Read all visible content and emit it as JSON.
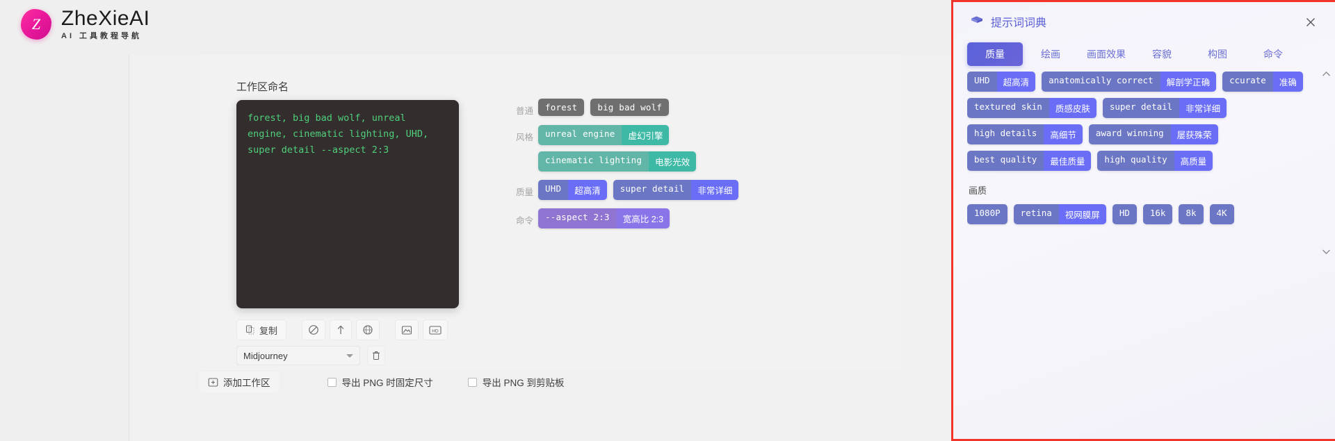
{
  "brand": {
    "logo_letter": "Z",
    "name": "ZheXieAI",
    "tagline": "AI 工具教程导航"
  },
  "workspace": {
    "label": "工作区命名",
    "prompt_text": "forest, big bad wolf, unreal engine, cinematic lighting, UHD, super detail --aspect 2:3",
    "toolbar": {
      "copy_label": "复制",
      "icons": [
        "clipboard-icon",
        "ban-icon",
        "arrow-up-icon",
        "globe-icon",
        "image-icon",
        "hd-icon"
      ]
    },
    "model": {
      "value": "Midjourney",
      "delete_icon": "trash-icon"
    },
    "tag_rows": [
      {
        "label": "普通",
        "color": "gray",
        "tags": [
          {
            "en": "forest",
            "cn": ""
          },
          {
            "en": "big bad wolf",
            "cn": ""
          }
        ]
      },
      {
        "label": "风格",
        "color": "teal",
        "tags": [
          {
            "en": "unreal engine",
            "cn": "虚幻引擎"
          },
          {
            "en": "cinematic lighting",
            "cn": "电影光效"
          }
        ]
      },
      {
        "label": "质量",
        "color": "blue",
        "tags": [
          {
            "en": "UHD",
            "cn": "超高清"
          },
          {
            "en": "super detail",
            "cn": "非常详细"
          }
        ]
      },
      {
        "label": "命令",
        "color": "purple",
        "tags": [
          {
            "en": "--aspect 2:3",
            "cn": "宽高比 2:3"
          }
        ]
      }
    ]
  },
  "bottom": {
    "add_workspace": "添加工作区",
    "checkbox_fixed_size": "导出 PNG 时固定尺寸",
    "checkbox_clipboard": "导出 PNG 到剪贴板"
  },
  "dictionary": {
    "icon": "book-icon",
    "title": "提示词词典",
    "close_icon": "close-icon",
    "tabs": [
      {
        "label": "质量",
        "active": true
      },
      {
        "label": "绘画",
        "active": false
      },
      {
        "label": "画面效果",
        "active": false
      },
      {
        "label": "容貌",
        "active": false
      },
      {
        "label": "构图",
        "active": false
      },
      {
        "label": "命令",
        "active": false
      }
    ],
    "groups": [
      {
        "section": "",
        "tags": [
          {
            "en": "UHD",
            "cn": "超高清"
          },
          {
            "en": "anatomically correct",
            "cn": "解剖学正确"
          },
          {
            "en": "ccurate",
            "cn": "准确"
          },
          {
            "en": "textured skin",
            "cn": "质感皮肤"
          },
          {
            "en": "super detail",
            "cn": "非常详细"
          },
          {
            "en": "high details",
            "cn": "高细节"
          },
          {
            "en": "award winning",
            "cn": "屡获殊荣"
          },
          {
            "en": "best quality",
            "cn": "最佳质量"
          },
          {
            "en": "high quality",
            "cn": "高质量"
          }
        ]
      },
      {
        "section": "画质",
        "tags": [
          {
            "en": "1080P",
            "cn": ""
          },
          {
            "en": "retina",
            "cn": "视网膜屏"
          },
          {
            "en": "HD",
            "cn": ""
          },
          {
            "en": "16k",
            "cn": ""
          },
          {
            "en": "8k",
            "cn": ""
          },
          {
            "en": "4K",
            "cn": ""
          }
        ]
      }
    ],
    "scroll_up_icon": "chevron-up-icon",
    "scroll_down_icon": "chevron-down-icon"
  },
  "colors": {
    "accent": "#5a62d8",
    "highlight_border": "#f1352b",
    "prompt_text": "#4fd07b",
    "prompt_bg": "#332d2d"
  }
}
